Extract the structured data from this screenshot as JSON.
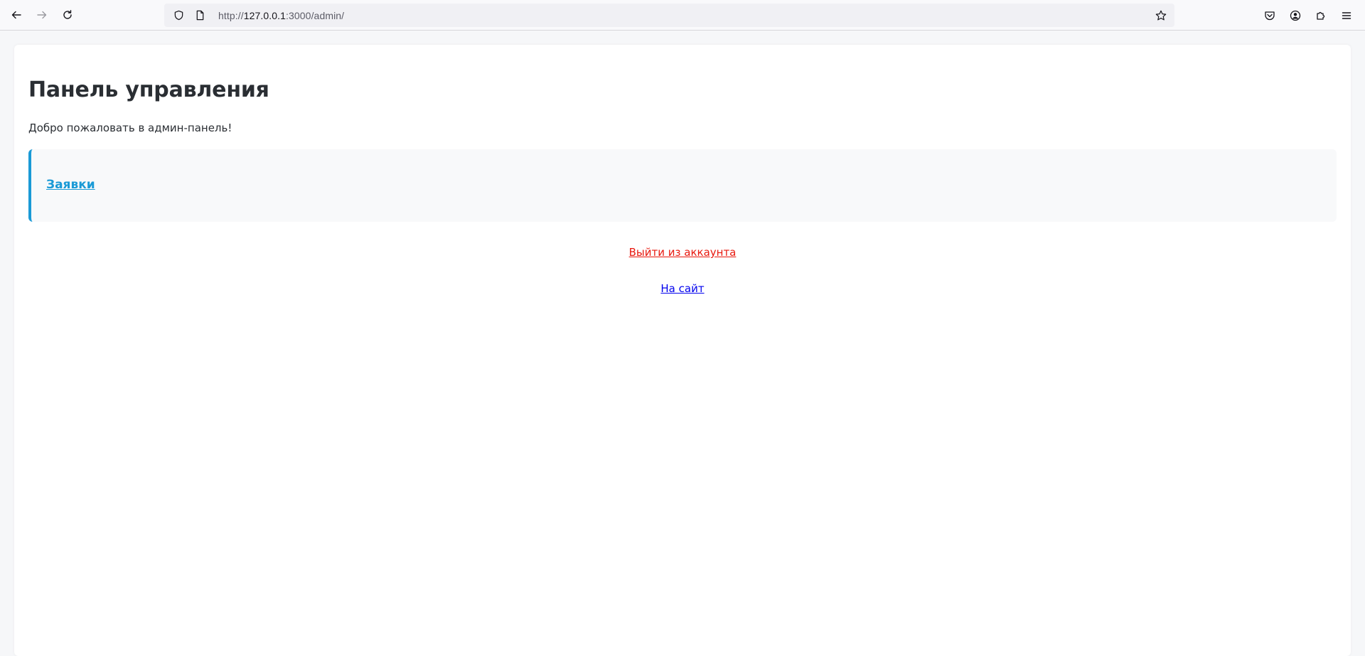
{
  "browser": {
    "url_scheme": "http://",
    "url_host": "127.0.0.1",
    "url_rest": ":3000/admin/",
    "icons": {
      "back": "back-arrow-icon",
      "forward": "forward-arrow-icon",
      "reload": "reload-icon",
      "shield": "shield-icon",
      "page": "page-icon",
      "bookmark": "star-icon",
      "pocket": "pocket-icon",
      "account": "account-icon",
      "extensions": "puzzle-icon",
      "menu": "hamburger-menu-icon"
    }
  },
  "page": {
    "title": "Панель управления",
    "welcome": "Добро пожаловать в админ-панель!",
    "menu": {
      "requests_label": "Заявки"
    },
    "logout_label": "Выйти из аккаунта",
    "site_label": "На сайт"
  },
  "colors": {
    "accent": "#1a9ad6",
    "danger": "#e8190f",
    "link": "#0000ee",
    "text": "#2a2e33"
  }
}
